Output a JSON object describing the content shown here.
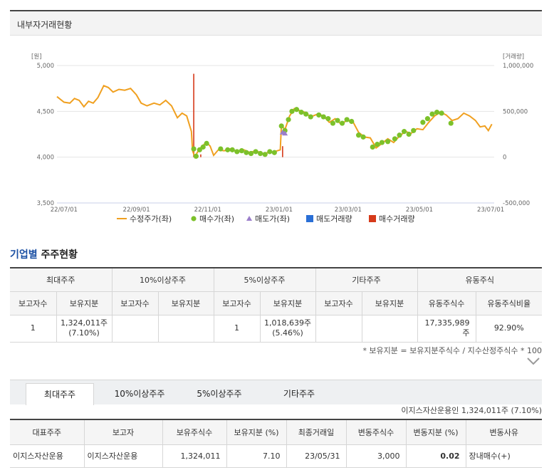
{
  "panel": {
    "title": "내부자거래현황"
  },
  "chart_data": {
    "type": "line",
    "left_axis": {
      "unit": "[원]",
      "ticks": [
        "5,000",
        "4,500",
        "4,000",
        "3,500"
      ],
      "range": [
        3500,
        5000
      ]
    },
    "right_axis": {
      "unit": "[거래량]",
      "ticks": [
        "1,000,000",
        "500,000",
        "0",
        "-500,000"
      ],
      "range": [
        -500000,
        1000000
      ]
    },
    "x_ticks": [
      "22/07/01",
      "22/09/01",
      "22/11/01",
      "23/01/01",
      "23/03/01",
      "23/05/01",
      "23/07/01"
    ],
    "x_tick_dates": [
      "2022-07-01",
      "2022-09-01",
      "2022-11-01",
      "2023-01-01",
      "2023-03-01",
      "2023-05-01",
      "2023-07-01"
    ],
    "x_range": [
      "2022-06-25",
      "2023-07-04"
    ],
    "price_series": {
      "name": "수정주가(좌)",
      "points": [
        [
          "2022-06-25",
          4660
        ],
        [
          "2022-07-01",
          4600
        ],
        [
          "2022-07-06",
          4590
        ],
        [
          "2022-07-10",
          4640
        ],
        [
          "2022-07-14",
          4620
        ],
        [
          "2022-07-18",
          4550
        ],
        [
          "2022-07-22",
          4610
        ],
        [
          "2022-07-26",
          4590
        ],
        [
          "2022-07-30",
          4650
        ],
        [
          "2022-08-04",
          4780
        ],
        [
          "2022-08-08",
          4760
        ],
        [
          "2022-08-12",
          4710
        ],
        [
          "2022-08-17",
          4740
        ],
        [
          "2022-08-22",
          4730
        ],
        [
          "2022-08-27",
          4750
        ],
        [
          "2022-09-01",
          4680
        ],
        [
          "2022-09-05",
          4590
        ],
        [
          "2022-09-10",
          4560
        ],
        [
          "2022-09-16",
          4590
        ],
        [
          "2022-09-21",
          4570
        ],
        [
          "2022-09-26",
          4620
        ],
        [
          "2022-10-01",
          4560
        ],
        [
          "2022-10-06",
          4430
        ],
        [
          "2022-10-10",
          4480
        ],
        [
          "2022-10-14",
          4450
        ],
        [
          "2022-10-18",
          4280
        ],
        [
          "2022-10-19",
          4070
        ],
        [
          "2022-10-21",
          4000
        ],
        [
          "2022-10-23",
          4050
        ],
        [
          "2022-10-27",
          4120
        ],
        [
          "2022-10-31",
          4160
        ],
        [
          "2022-11-03",
          4120
        ],
        [
          "2022-11-06",
          4020
        ],
        [
          "2022-11-10",
          4080
        ],
        [
          "2022-11-15",
          4070
        ],
        [
          "2022-11-20",
          4090
        ],
        [
          "2022-11-26",
          4060
        ],
        [
          "2022-12-02",
          4080
        ],
        [
          "2022-12-07",
          4050
        ],
        [
          "2022-12-12",
          4070
        ],
        [
          "2022-12-18",
          4040
        ],
        [
          "2022-12-23",
          4050
        ],
        [
          "2022-12-28",
          4060
        ],
        [
          "2023-01-02",
          4080
        ],
        [
          "2023-01-03",
          4350
        ],
        [
          "2023-01-06",
          4300
        ],
        [
          "2023-01-10",
          4450
        ],
        [
          "2023-01-14",
          4530
        ],
        [
          "2023-01-18",
          4510
        ],
        [
          "2023-01-23",
          4490
        ],
        [
          "2023-01-28",
          4440
        ],
        [
          "2023-02-03",
          4470
        ],
        [
          "2023-02-08",
          4450
        ],
        [
          "2023-02-13",
          4380
        ],
        [
          "2023-02-18",
          4420
        ],
        [
          "2023-02-23",
          4360
        ],
        [
          "2023-02-28",
          4400
        ],
        [
          "2023-03-05",
          4390
        ],
        [
          "2023-03-10",
          4270
        ],
        [
          "2023-03-15",
          4220
        ],
        [
          "2023-03-20",
          4210
        ],
        [
          "2023-03-25",
          4100
        ],
        [
          "2023-03-30",
          4150
        ],
        [
          "2023-04-04",
          4200
        ],
        [
          "2023-04-09",
          4160
        ],
        [
          "2023-04-14",
          4230
        ],
        [
          "2023-04-19",
          4280
        ],
        [
          "2023-04-24",
          4260
        ],
        [
          "2023-04-29",
          4310
        ],
        [
          "2023-05-04",
          4300
        ],
        [
          "2023-05-09",
          4380
        ],
        [
          "2023-05-14",
          4450
        ],
        [
          "2023-05-19",
          4490
        ],
        [
          "2023-05-24",
          4460
        ],
        [
          "2023-05-29",
          4400
        ],
        [
          "2023-06-03",
          4420
        ],
        [
          "2023-06-08",
          4480
        ],
        [
          "2023-06-13",
          4450
        ],
        [
          "2023-06-18",
          4400
        ],
        [
          "2023-06-22",
          4330
        ],
        [
          "2023-06-26",
          4340
        ],
        [
          "2023-06-29",
          4290
        ],
        [
          "2023-07-02",
          4360
        ]
      ]
    },
    "buy_series": {
      "name": "매수가(좌)",
      "points": [
        [
          "2022-10-20",
          4090
        ],
        [
          "2022-10-22",
          4010
        ],
        [
          "2022-10-25",
          4080
        ],
        [
          "2022-10-28",
          4110
        ],
        [
          "2022-10-31",
          4150
        ],
        [
          "2022-11-12",
          4090
        ],
        [
          "2022-11-18",
          4080
        ],
        [
          "2022-11-22",
          4080
        ],
        [
          "2022-11-26",
          4060
        ],
        [
          "2022-11-30",
          4070
        ],
        [
          "2022-12-04",
          4050
        ],
        [
          "2022-12-08",
          4040
        ],
        [
          "2022-12-12",
          4060
        ],
        [
          "2022-12-16",
          4040
        ],
        [
          "2022-12-20",
          4030
        ],
        [
          "2022-12-24",
          4060
        ],
        [
          "2022-12-28",
          4050
        ],
        [
          "2023-01-03",
          4340
        ],
        [
          "2023-01-06",
          4290
        ],
        [
          "2023-01-09",
          4410
        ],
        [
          "2023-01-12",
          4500
        ],
        [
          "2023-01-16",
          4520
        ],
        [
          "2023-01-20",
          4490
        ],
        [
          "2023-01-24",
          4470
        ],
        [
          "2023-01-28",
          4440
        ],
        [
          "2023-02-04",
          4460
        ],
        [
          "2023-02-08",
          4440
        ],
        [
          "2023-02-12",
          4420
        ],
        [
          "2023-02-16",
          4370
        ],
        [
          "2023-02-20",
          4400
        ],
        [
          "2023-02-24",
          4370
        ],
        [
          "2023-02-28",
          4410
        ],
        [
          "2023-03-04",
          4390
        ],
        [
          "2023-03-10",
          4240
        ],
        [
          "2023-03-14",
          4220
        ],
        [
          "2023-03-22",
          4110
        ],
        [
          "2023-03-26",
          4140
        ],
        [
          "2023-03-30",
          4160
        ],
        [
          "2023-04-04",
          4170
        ],
        [
          "2023-04-10",
          4200
        ],
        [
          "2023-04-14",
          4240
        ],
        [
          "2023-04-18",
          4280
        ],
        [
          "2023-04-22",
          4250
        ],
        [
          "2023-04-26",
          4290
        ],
        [
          "2023-05-04",
          4380
        ],
        [
          "2023-05-08",
          4420
        ],
        [
          "2023-05-12",
          4470
        ],
        [
          "2023-05-16",
          4490
        ],
        [
          "2023-05-20",
          4480
        ],
        [
          "2023-05-28",
          4370
        ]
      ]
    },
    "sell_series": {
      "name": "매도가(좌)",
      "points": [
        [
          "2023-01-04",
          4270
        ],
        [
          "2023-01-06",
          4260
        ]
      ]
    },
    "sell_volume": {
      "name": "매도거래량"
    },
    "buy_volume": {
      "name": "매수거래량",
      "bars": [
        [
          "2022-10-20",
          910000
        ],
        [
          "2022-10-26",
          30000
        ],
        [
          "2023-01-04",
          120000
        ]
      ]
    },
    "colors": {
      "price": "#f0a020",
      "buy": "#7cc12a",
      "sell": "#9b7ecb",
      "sell_volume": "#2a6fd6",
      "buy_volume": "#d63a1a"
    }
  },
  "section": {
    "title_highlight": "기업별",
    "title_rest": "주주현황"
  },
  "holders_table": {
    "groups": [
      "최대주주",
      "10%이상주주",
      "5%이상주주",
      "기타주주",
      "유동주식"
    ],
    "subheads": [
      "보고자수",
      "보유지분",
      "보고자수",
      "보유지분",
      "보고자수",
      "보유지분",
      "보고자수",
      "보유지분",
      "유동주식수",
      "유동주식비율"
    ],
    "row": [
      "1",
      "1,324,011주",
      "(7.10%)",
      "",
      "",
      "1",
      "1,018,639주",
      "(5.46%)",
      "",
      "",
      "17,335,989주",
      "92.90%"
    ]
  },
  "note": "* 보유지분 = 보유지분주식수 / 지수산정주식수 * 100",
  "tabs": [
    "최대주주",
    "10%이상주주",
    "5%이상주주",
    "기타주주"
  ],
  "holder_summary": "이지스자산운용인 1,324,011주 (7.10%)",
  "detail_table": {
    "headers": [
      "대표주주",
      "보고자",
      "보유주식수",
      "보유지분 (%)",
      "최종거래일",
      "변동주식수",
      "변동지분 (%)",
      "변동사유"
    ],
    "row": [
      "이지스자산운용",
      "이지스자산운용",
      "1,324,011",
      "7.10",
      "23/05/31",
      "3,000",
      "0.02",
      "장내매수(+)"
    ]
  }
}
